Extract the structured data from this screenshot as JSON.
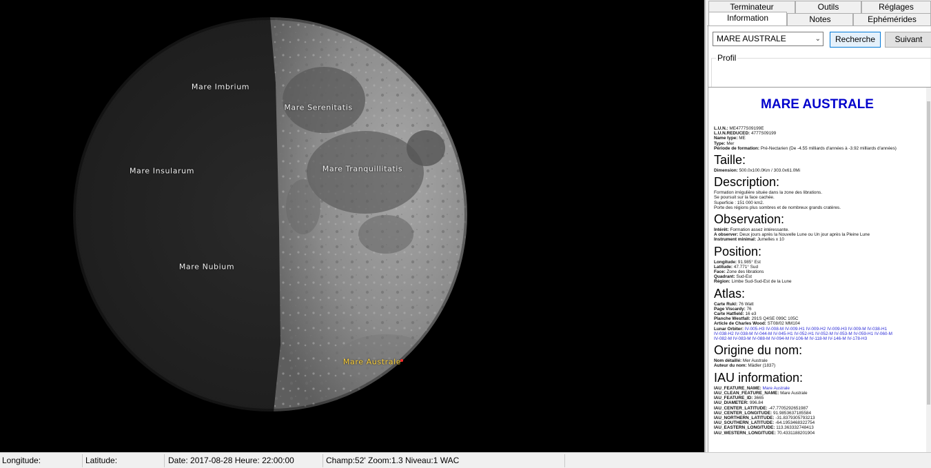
{
  "moon_labels": [
    {
      "name": "Mare Imbrium",
      "key": "imbrium"
    },
    {
      "name": "Mare Serenitatis",
      "key": "serenitatis"
    },
    {
      "name": "Mare Insularum",
      "key": "insularum"
    },
    {
      "name": "Mare Tranquillitatis",
      "key": "tranquillitatis"
    },
    {
      "name": "Mare Nubium",
      "key": "nubium"
    },
    {
      "name": "Mare Australe",
      "key": "australe"
    }
  ],
  "tabs": {
    "terminateur": "Terminateur",
    "outils": "Outils",
    "reglages": "Réglages",
    "information": "Information",
    "notes": "Notes",
    "ephemerides": "Ephémérides"
  },
  "search": {
    "selected": "MARE AUSTRALE",
    "recherche": "Recherche",
    "suivant": "Suivant",
    "profil": "Profil"
  },
  "doc": {
    "title": "MARE AUSTRALE",
    "header_rows": [
      {
        "k": "L.U.N.:",
        "v": "ME4777S09199E"
      },
      {
        "k": "L.U.N.REDUCED:",
        "v": "4777S09199"
      },
      {
        "k": "Name type:",
        "v": "ME"
      },
      {
        "k": "Type:",
        "v": "Mer"
      },
      {
        "k": "Période de formation:",
        "v": "Pré-Nectarien (De -4.55 milliards d'années à -3.92 milliards d'années)"
      }
    ],
    "taille": {
      "heading": "Taille:",
      "rows": [
        {
          "k": "Dimension:",
          "v": "500.0x100.0Km / 303.0x61.0Mi"
        }
      ]
    },
    "description": {
      "heading": "Description:",
      "lines": [
        "Formation irrégulière située dans la zone des librations.",
        "Se poursuit sur la face cachée.",
        "Superficie : 151 000 km2.",
        "Porte des régions plus sombres et de nombreux grands cratères."
      ]
    },
    "observation": {
      "heading": "Observation:",
      "rows": [
        {
          "k": "Intérêt:",
          "v": "Formation assez intéressante."
        },
        {
          "k": "A observer:",
          "v": "Deux jours après la Nouvelle Lune ou Un jour après la Pleine Lune"
        },
        {
          "k": "Instrument minimal:",
          "v": "Jumelles x 10"
        }
      ]
    },
    "position": {
      "heading": "Position:",
      "rows": [
        {
          "k": "Longitude:",
          "v": "91.985° Est"
        },
        {
          "k": "Latitude:",
          "v": "47.771° Sud"
        },
        {
          "k": "Face:",
          "v": "Zone des librations"
        },
        {
          "k": "Quadrant:",
          "v": "Sud-Est"
        },
        {
          "k": "Région:",
          "v": "Limbe Sud-Sud-Est de la Lune"
        }
      ]
    },
    "atlas": {
      "heading": "Atlas:",
      "rows": [
        {
          "k": "Carte Rukl:",
          "v": "76 Watt"
        },
        {
          "k": "Page Viscardy:",
          "v": "76"
        },
        {
          "k": "Carte Hatfield:",
          "v": "16 e3"
        },
        {
          "k": "Planche Westfall:",
          "v": "291S Q4SE 099C 105C"
        },
        {
          "k": "Article de Charles Wood:",
          "v": "ST08/02 MM104"
        }
      ],
      "orbiter_label": "Lunar Orbiter:",
      "orbiter_line1": "IV-005-H3  IV-008-M  IV-009-H1  IV-009-H2  IV-009-H3  IV-009-M  IV-038-H1",
      "orbiter_line2": "IV-038-H2  IV-038-M  IV-044-M  IV-045-H1  IV-052-H1  IV-052-M  IV-053-M  IV-059-H1  IV-060-M",
      "orbiter_line3": "IV-082-M  IV-083-M  IV-088-M  IV-094-M  IV-106-M  IV-118-M  IV-146-M  IV-178-H3"
    },
    "origine": {
      "heading": "Origine du nom:",
      "rows": [
        {
          "k": "Nom détaillé:",
          "v": "Mer Australe"
        },
        {
          "k": "Auteur du nom:",
          "v": "Mädler (1837)"
        }
      ]
    },
    "iau": {
      "heading": "IAU information:",
      "feature_name_label": "IAU_FEATURE_NAME:",
      "feature_name_link": "Mare Australe",
      "rows": [
        {
          "k": "IAU_CLEAN_FEATURE_NAME:",
          "v": "Mare Australe"
        },
        {
          "k": "IAU_FEATURE_ID:",
          "v": "3665"
        },
        {
          "k": "IAU_DIAMETER:",
          "v": "996.84"
        },
        {
          "k": "IAU_CENTER_LATITUDE:",
          "v": "-47.7705292651987"
        },
        {
          "k": "IAU_CENTER_LONGITUDE:",
          "v": "91.9853637185584"
        },
        {
          "k": "IAU_NORTHERN_LATITUDE:",
          "v": "-31.8379305793213"
        },
        {
          "k": "IAU_SOUTHERN_LATITUDE:",
          "v": "-64.1953468322754"
        },
        {
          "k": "IAU_EASTERN_LONGITUDE:",
          "v": "113.363332748413"
        },
        {
          "k": "IAU_WESTERN_LONGITUDE:",
          "v": "70.4331188201904"
        }
      ]
    }
  },
  "status": {
    "longitude": "Longitude:",
    "latitude": "Latitude:",
    "date": "Date: 2017-08-28   Heure: 22:00:00",
    "champ": "Champ:52' Zoom:1.3  Niveau:1 WAC"
  }
}
